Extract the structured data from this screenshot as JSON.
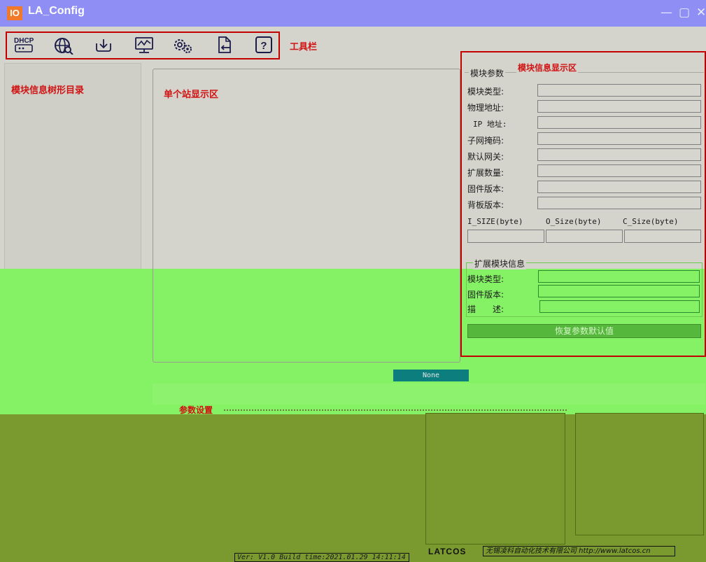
{
  "window": {
    "logo_text": "IO",
    "title": "LA_Config",
    "min_glyph": "—",
    "max_glyph": "▢",
    "close_glyph": "✕",
    "titlebar_color": "#8f8ef4"
  },
  "toolbar": {
    "label": "工具栏",
    "dhcp_text": "DHCP",
    "buttons": [
      {
        "name": "dhcp-icon"
      },
      {
        "name": "network-search-icon"
      },
      {
        "name": "download-icon"
      },
      {
        "name": "monitor-icon"
      },
      {
        "name": "settings-icon"
      },
      {
        "name": "export-icon"
      },
      {
        "name": "help-icon",
        "glyph": "?"
      }
    ]
  },
  "tree": {
    "label": "模块信息树形目录"
  },
  "station": {
    "label": "单个站显示区"
  },
  "info": {
    "title": "模块信息显示区",
    "group_label": "模块参数",
    "fields": [
      {
        "label": "模块类型:",
        "value": ""
      },
      {
        "label": "物理地址:",
        "value": ""
      },
      {
        "label": "IP 地址:",
        "value": ""
      },
      {
        "label": "子网掩码:",
        "value": ""
      },
      {
        "label": "默认网关:",
        "value": ""
      },
      {
        "label": "扩展数量:",
        "value": ""
      },
      {
        "label": "固件版本:",
        "value": ""
      },
      {
        "label": "背板版本:",
        "value": ""
      }
    ],
    "size_headers": [
      "I_SIZE(byte)",
      "O_Size(byte)",
      "C_Size(byte)"
    ],
    "size_values": [
      "",
      "",
      ""
    ],
    "ext_group_label": "扩展模块信息",
    "ext_fields": [
      {
        "label": "模块类型:",
        "value": ""
      },
      {
        "label": "固件版本:",
        "value": ""
      },
      {
        "label": "描　　述:",
        "value": ""
      }
    ],
    "restore_label": "恢复参数默认值"
  },
  "status": {
    "none_label": "None"
  },
  "params": {
    "label": "参数设置"
  },
  "footer": {
    "version": "Ver: V1.0 Build time:2021.01.29 14:11:14",
    "brand": "LATCOS",
    "company": "无锡凌科自动化技术有限公司 http://www.latcos.cn"
  },
  "colors": {
    "accent_red": "#d01212",
    "green_overlay": "#85f265",
    "olive": "#7a9a30",
    "teal_badge": "#0c7e7e"
  }
}
